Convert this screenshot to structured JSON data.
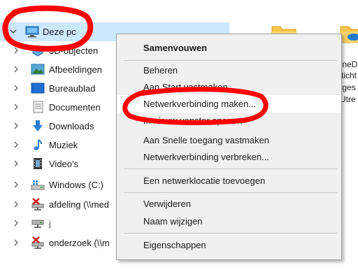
{
  "nav": {
    "items": [
      {
        "label": "Deze pc"
      },
      {
        "label": "3D-objecten"
      },
      {
        "label": "Afbeeldingen"
      },
      {
        "label": "Bureaublad"
      },
      {
        "label": "Documenten"
      },
      {
        "label": "Downloads"
      },
      {
        "label": "Muziek"
      },
      {
        "label": "Video's"
      },
      {
        "label": "Windows (C:)"
      },
      {
        "label": "afdeling (\\\\med"
      },
      {
        "label": "j"
      },
      {
        "label": "onderzoek (\\\\m"
      }
    ]
  },
  "content": {
    "lines": [
      "OneDr",
      "Sticht",
      "loges",
      "l Utre"
    ]
  },
  "menu": {
    "items": [
      {
        "label": "Samenvouwen"
      },
      {
        "label": "Beheren"
      },
      {
        "label": "Aan Start vastmaken"
      },
      {
        "label": "Netwerkverbinding maken..."
      },
      {
        "label": "In nieuw venster openen"
      },
      {
        "label": "Aan Snelle toegang vastmaken"
      },
      {
        "label": "Netwerkverbinding verbreken..."
      },
      {
        "label": "Een netwerklocatie toevoegen"
      },
      {
        "label": "Verwijderen"
      },
      {
        "label": "Naam wijzigen"
      },
      {
        "label": "Eigenschappen"
      }
    ]
  },
  "colors": {
    "selection": "#cce8ff",
    "menu_bg": "#f0f0f0",
    "annotation": "#ff0000",
    "folder": "#f6c64a"
  }
}
